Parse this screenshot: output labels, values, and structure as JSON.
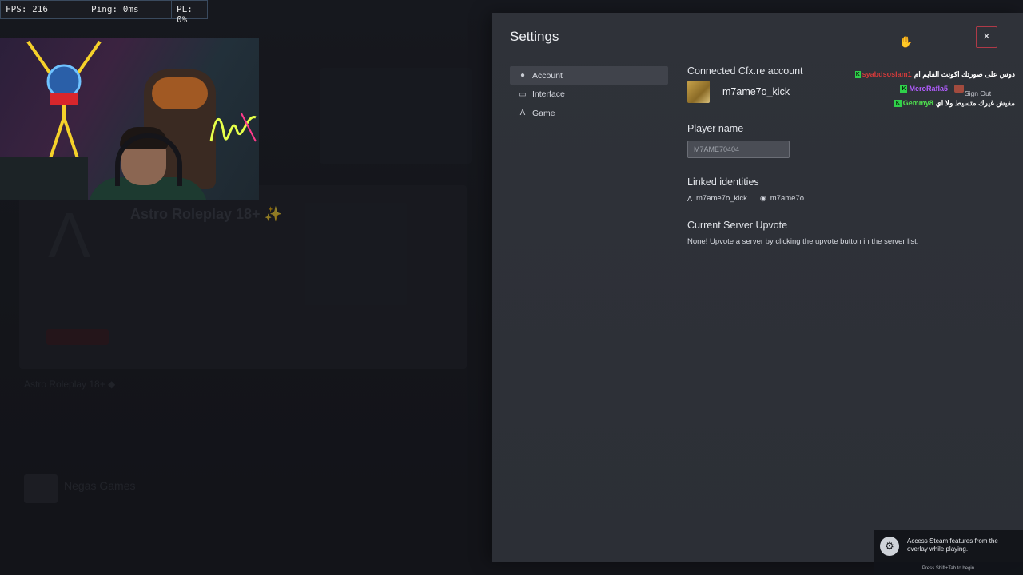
{
  "stats": {
    "fps": "FPS: 216",
    "ping": "Ping: 0ms",
    "pl": "PL: 0%"
  },
  "background": {
    "server_name": "Astro Roleplay 18+ ✨",
    "row_name": "Astro Roleplay 18+ ◆",
    "row2_name": "Negas Games"
  },
  "settings": {
    "title": "Settings",
    "close_icon": "×",
    "nav": [
      {
        "label": "Account",
        "icon": "user-icon"
      },
      {
        "label": "Interface",
        "icon": "monitor-icon"
      },
      {
        "label": "Game",
        "icon": "fivem-icon"
      }
    ],
    "account": {
      "connected_title": "Connected Cfx.re account",
      "username": "m7ame7o_kick",
      "sign_out": "Sign Out",
      "player_name_title": "Player name",
      "player_name_value": "M7AME70404",
      "linked_title": "Linked identities",
      "linked": [
        {
          "icon": "fivem-icon",
          "name": "m7ame7o_kick"
        },
        {
          "icon": "discord-icon",
          "name": "m7ame7o"
        }
      ],
      "upvote_title": "Current Server Upvote",
      "upvote_text": "None! Upvote a server by clicking the upvote button in the server list."
    }
  },
  "chat": [
    {
      "user": "syabdsoslam1",
      "text": "دوس على صورتك اكونت الفايم ام",
      "color": "#d03a3a"
    },
    {
      "user": "MeroRafla5",
      "text": "",
      "color": "#b25dff"
    },
    {
      "user": "Gemmy8",
      "text": "مفيش غيرك متسيط ولا اي",
      "color": "#4fe04f"
    }
  ],
  "steam": {
    "message": "Access Steam features from the overlay while playing.",
    "hint": "Press Shift+Tab to begin"
  }
}
